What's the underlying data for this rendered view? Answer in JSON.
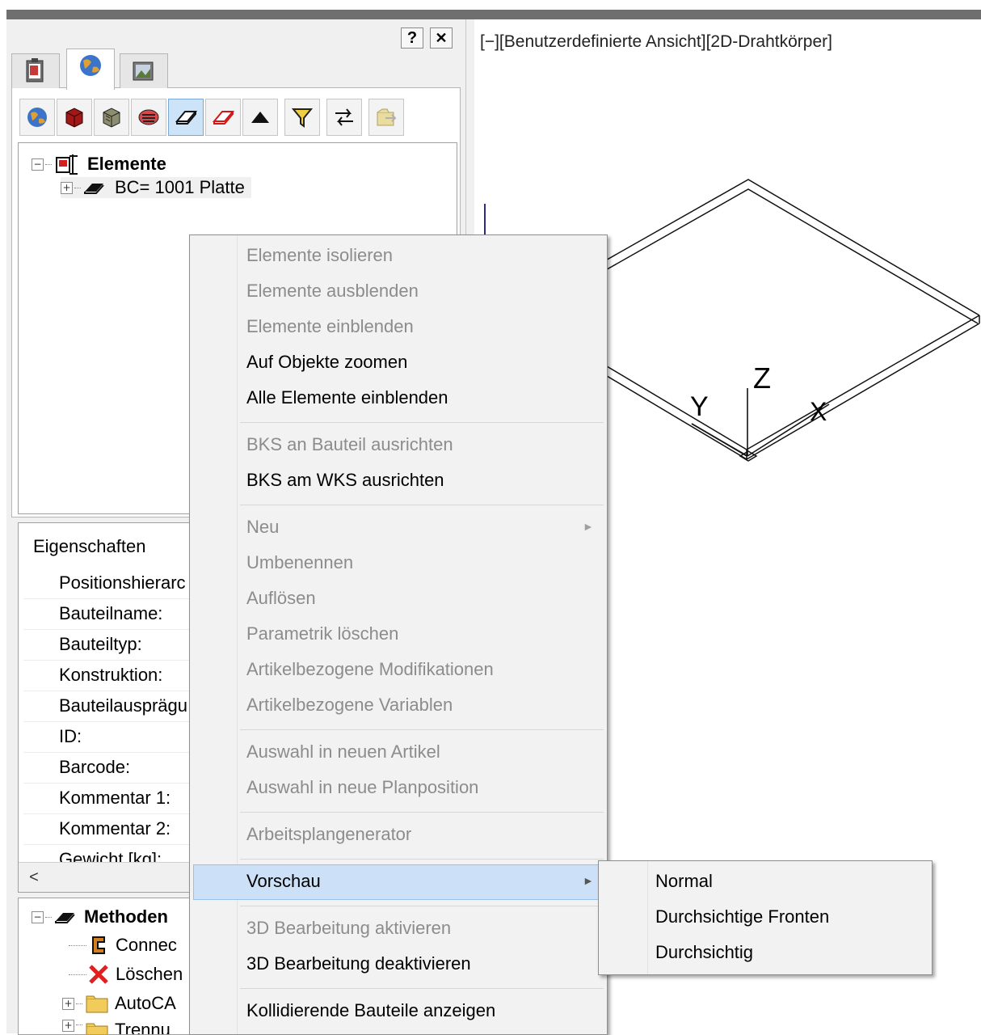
{
  "window": {
    "help_label": "?",
    "close_label": "✕"
  },
  "tabs": [
    {
      "icon": "clipboard-icon"
    },
    {
      "icon": "globe-icon"
    },
    {
      "icon": "image-folder-icon"
    }
  ],
  "tree": {
    "root_label": "Elemente",
    "child_label": "BC= 1001 Platte",
    "collapse_glyph": "−",
    "expand_glyph": "+"
  },
  "properties": {
    "header": "Eigenschaften",
    "rows": [
      "Positionshierarc",
      "Bauteilname:",
      "Bauteiltyp:",
      "Konstruktion:",
      "Bauteilausprägu",
      "ID:",
      "Barcode:",
      "Kommentar 1:",
      "Kommentar 2:",
      "Gewicht [kg]:"
    ],
    "scroll_left": "<"
  },
  "methods": {
    "root_label": "Methoden",
    "items": [
      "Connec",
      "Löschen",
      "AutoCA",
      "Trennu"
    ]
  },
  "viewport": {
    "title": "[−][Benutzerdefinierte Ansicht][2D-Drahtkörper]",
    "axis_z": "Z",
    "axis_y": "Y",
    "axis_x": "X"
  },
  "context_menu": {
    "items": [
      {
        "label": "Elemente isolieren",
        "enabled": false
      },
      {
        "label": "Elemente ausblenden",
        "enabled": false
      },
      {
        "label": "Elemente einblenden",
        "enabled": false
      },
      {
        "label": "Auf Objekte zoomen",
        "enabled": true
      },
      {
        "label": "Alle Elemente einblenden",
        "enabled": true
      },
      {
        "label": "BKS an Bauteil ausrichten",
        "enabled": false
      },
      {
        "label": "BKS am WKS ausrichten",
        "enabled": true
      },
      {
        "label": "Neu",
        "enabled": false
      },
      {
        "label": "Umbenennen",
        "enabled": false
      },
      {
        "label": "Auflösen",
        "enabled": false
      },
      {
        "label": "Parametrik löschen",
        "enabled": false
      },
      {
        "label": "Artikelbezogene Modifikationen",
        "enabled": false
      },
      {
        "label": "Artikelbezogene Variablen",
        "enabled": false
      },
      {
        "label": "Auswahl in neuen Artikel",
        "enabled": false
      },
      {
        "label": "Auswahl in neue Planposition",
        "enabled": false
      },
      {
        "label": "Arbeitsplangenerator",
        "enabled": false
      },
      {
        "label": "Vorschau",
        "enabled": true
      },
      {
        "label": "3D Bearbeitung aktivieren",
        "enabled": false
      },
      {
        "label": "3D Bearbeitung deaktivieren",
        "enabled": true
      },
      {
        "label": "Kollidierende Bauteile anzeigen",
        "enabled": true
      }
    ],
    "submenu_arrow": "►"
  },
  "submenu": {
    "items": [
      "Normal",
      "Durchsichtige Fronten",
      "Durchsichtig"
    ]
  }
}
